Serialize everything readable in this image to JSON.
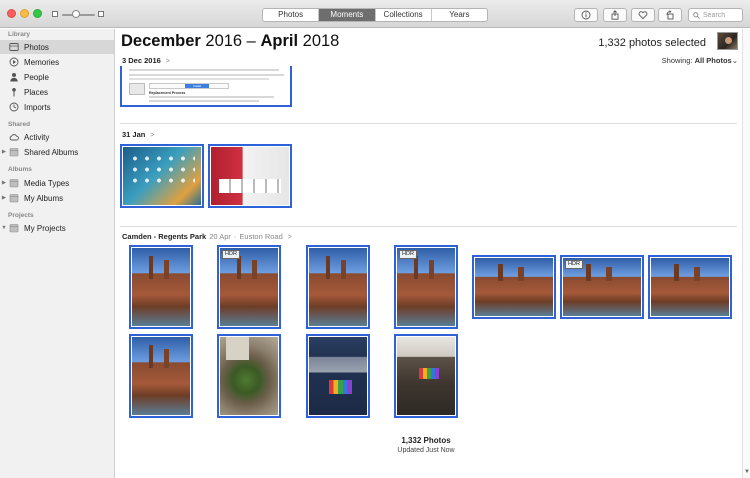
{
  "toolbar": {
    "tabs": [
      "Photos",
      "Moments",
      "Collections",
      "Years"
    ],
    "active_tab": "Moments",
    "search_placeholder": "Search",
    "icons": [
      "info-icon",
      "share-icon",
      "heart-icon",
      "rotate-icon"
    ]
  },
  "sidebar": {
    "sections": [
      {
        "heading": "Library",
        "items": [
          {
            "label": "Photos",
            "icon": "photos-icon",
            "selected": true
          },
          {
            "label": "Memories",
            "icon": "memories-icon"
          },
          {
            "label": "People",
            "icon": "people-icon"
          },
          {
            "label": "Places",
            "icon": "places-icon"
          },
          {
            "label": "Imports",
            "icon": "imports-icon"
          }
        ]
      },
      {
        "heading": "Shared",
        "items": [
          {
            "label": "Activity",
            "icon": "cloud-icon"
          },
          {
            "label": "Shared Albums",
            "icon": "folder-icon",
            "disclosure": true
          }
        ]
      },
      {
        "heading": "Albums",
        "items": [
          {
            "label": "Media Types",
            "icon": "folder-icon",
            "disclosure": true
          },
          {
            "label": "My Albums",
            "icon": "folder-icon",
            "disclosure": true
          }
        ]
      },
      {
        "heading": "Projects",
        "items": [
          {
            "label": "My Projects",
            "icon": "folder-icon",
            "disclosure": true,
            "expanded": true
          }
        ]
      }
    ]
  },
  "header": {
    "title_bold_1": "December",
    "title_light_1": "2016 – ",
    "title_bold_2": "April",
    "title_light_2": "2018",
    "selected_count": "1,332 photos selected",
    "showing_label": "Showing:",
    "showing_value": "All Photos"
  },
  "moments": [
    {
      "title": "3 Dec 2016",
      "subtitle": "",
      "location": ""
    },
    {
      "title": "31 Jan",
      "subtitle": "",
      "location": ""
    },
    {
      "title": "Camden - Regents Park",
      "subtitle": "20 Apr",
      "location": "Euston Road"
    }
  ],
  "doc_preview": {
    "heading": "Replacement Process",
    "button": "Install"
  },
  "badges": {
    "hdr": "HDR"
  },
  "footer": {
    "count": "1,332 Photos",
    "updated": "Updated Just Now"
  },
  "colors": {
    "selection": "#2f62d8"
  }
}
